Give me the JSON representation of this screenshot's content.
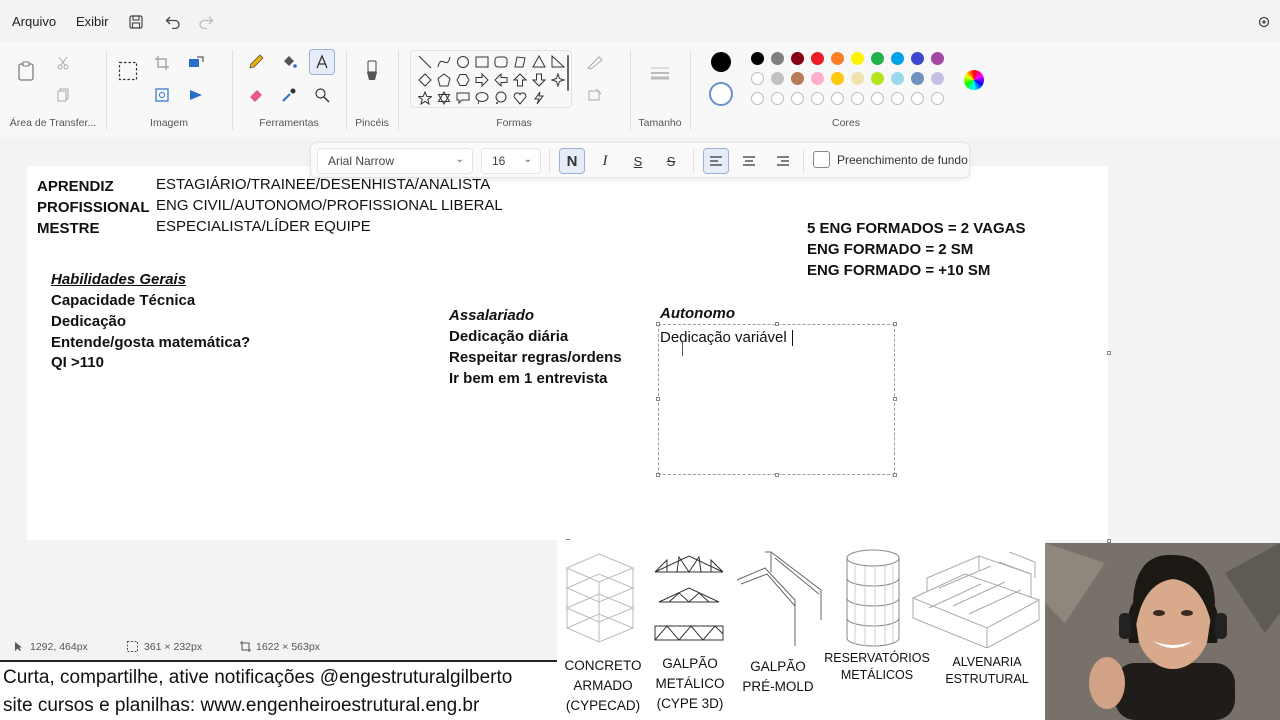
{
  "menu": {
    "file": "Arquivo",
    "view": "Exibir"
  },
  "ribbon": {
    "groups": {
      "clipboard": "Área de Transfer...",
      "image": "Imagem",
      "tools": "Ferramentas",
      "brushes": "Pincéis",
      "shapes": "Formas",
      "size": "Tamanho",
      "colors": "Cores"
    },
    "palette_row1": [
      "#000000",
      "#7f7f7f",
      "#880015",
      "#ed1c24",
      "#ff7f27",
      "#fff200",
      "#22b14c",
      "#00a2e8",
      "#3f48cc",
      "#a349a4"
    ],
    "palette_row2": [
      "#ffffff",
      "#c3c3c3",
      "#b97a57",
      "#ffaec9",
      "#ffc90e",
      "#efe4b0",
      "#b5e61d",
      "#99d9ea",
      "#7092be",
      "#c8bfe7"
    ],
    "primary_color": "#000000",
    "secondary_color": "#ffffff"
  },
  "text_toolbar": {
    "font": "Arial Narrow",
    "size": "16",
    "bold": "N",
    "italic": "I",
    "underline": "S",
    "strike": "S",
    "fill_label": "Preenchimento de fundo"
  },
  "canvas": {
    "levels": [
      {
        "name": "APRENDIZ",
        "role": "ESTAGIÁRIO/TRAINEE/DESENHISTA/ANALISTA"
      },
      {
        "name": "PROFISSIONAL",
        "role": "ENG CIVIL/AUTONOMO/PROFISSIONAL LIBERAL"
      },
      {
        "name": "MESTRE",
        "role": "ESPECIALISTA/LÍDER EQUIPE"
      }
    ],
    "stats": [
      "5 ENG FORMADOS = 2 VAGAS",
      "ENG FORMADO = 2 SM",
      "ENG FORMADO = +10 SM"
    ],
    "skills_title": "Habilidades Gerais",
    "skills": [
      "Capacidade Técnica",
      "Dedicação",
      "Entende/gosta matemática?",
      "QI >110"
    ],
    "salaried_title": "Assalariado",
    "salaried": [
      "Dedicação diária",
      "Respeitar regras/ordens",
      "Ir bem em 1 entrevista"
    ],
    "autonomous_title": "Autonomo",
    "editing_text": "Dedicação variável"
  },
  "status": {
    "cursor": "1292, 464px",
    "selection": "361 × 232px",
    "canvas_size": "1622 × 563px"
  },
  "banner": {
    "line1": "Curta, compartilhe, ative notificações @engestruturalgilberto",
    "line2": "site cursos e planilhas: www.engenheiroestrutural.eng.br"
  },
  "structures": [
    {
      "l1": "CONCRETO",
      "l2": "ARMADO",
      "l3": "(CYPECAD)"
    },
    {
      "l1": "GALPÃO",
      "l2": "METÁLICO",
      "l3": "(CYPE 3D)"
    },
    {
      "l1": "GALPÃO",
      "l2": "PRÉ-MOLD",
      "l3": ""
    },
    {
      "l1": "RESERVATÓRIOS",
      "l2": "METÁLICOS",
      "l3": ""
    },
    {
      "l1": "ALVENARIA",
      "l2": "ESTRUTURAL",
      "l3": ""
    }
  ]
}
